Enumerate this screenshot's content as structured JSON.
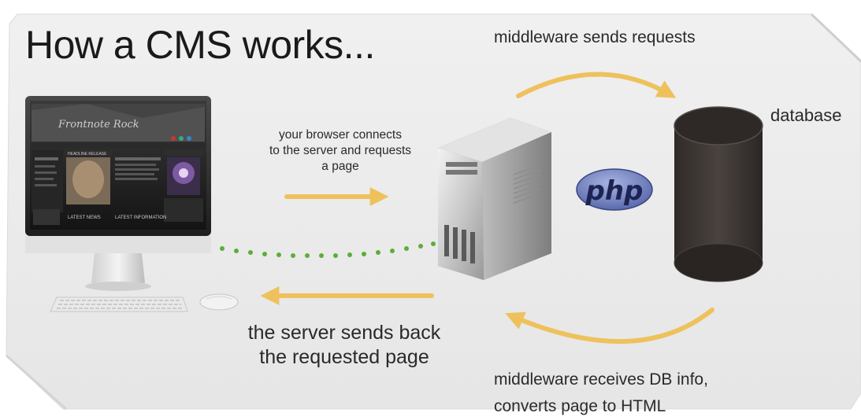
{
  "title": "How a CMS works...",
  "labels": {
    "middleware_sends": "middleware sends requests",
    "database": "database",
    "browser_connects_1": "your browser connects",
    "browser_connects_2": "to the server and requests",
    "browser_connects_3": "a page",
    "server_sends_1": "the server sends back",
    "server_sends_2": "the requested page",
    "middleware_receives_1": "middleware receives DB info,",
    "middleware_receives_2": "converts page to HTML"
  },
  "php_logo_text": "php",
  "website_screen": {
    "brand": "Frontnote Rock",
    "heading_1": "HEADLINE RELEASE",
    "heading_2": "LATEST NEWS",
    "heading_3": "LATEST INFORMATION"
  },
  "colors": {
    "background": "#ececec",
    "arrow": "#eec15c",
    "dots": "#5cae3a",
    "database": "#3b3533",
    "php_logo": "#6b7ab8"
  },
  "icons": [
    "computer-monitor-icon",
    "keyboard-icon",
    "mouse-icon",
    "server-tower-icon",
    "database-cylinder-icon",
    "php-logo"
  ]
}
